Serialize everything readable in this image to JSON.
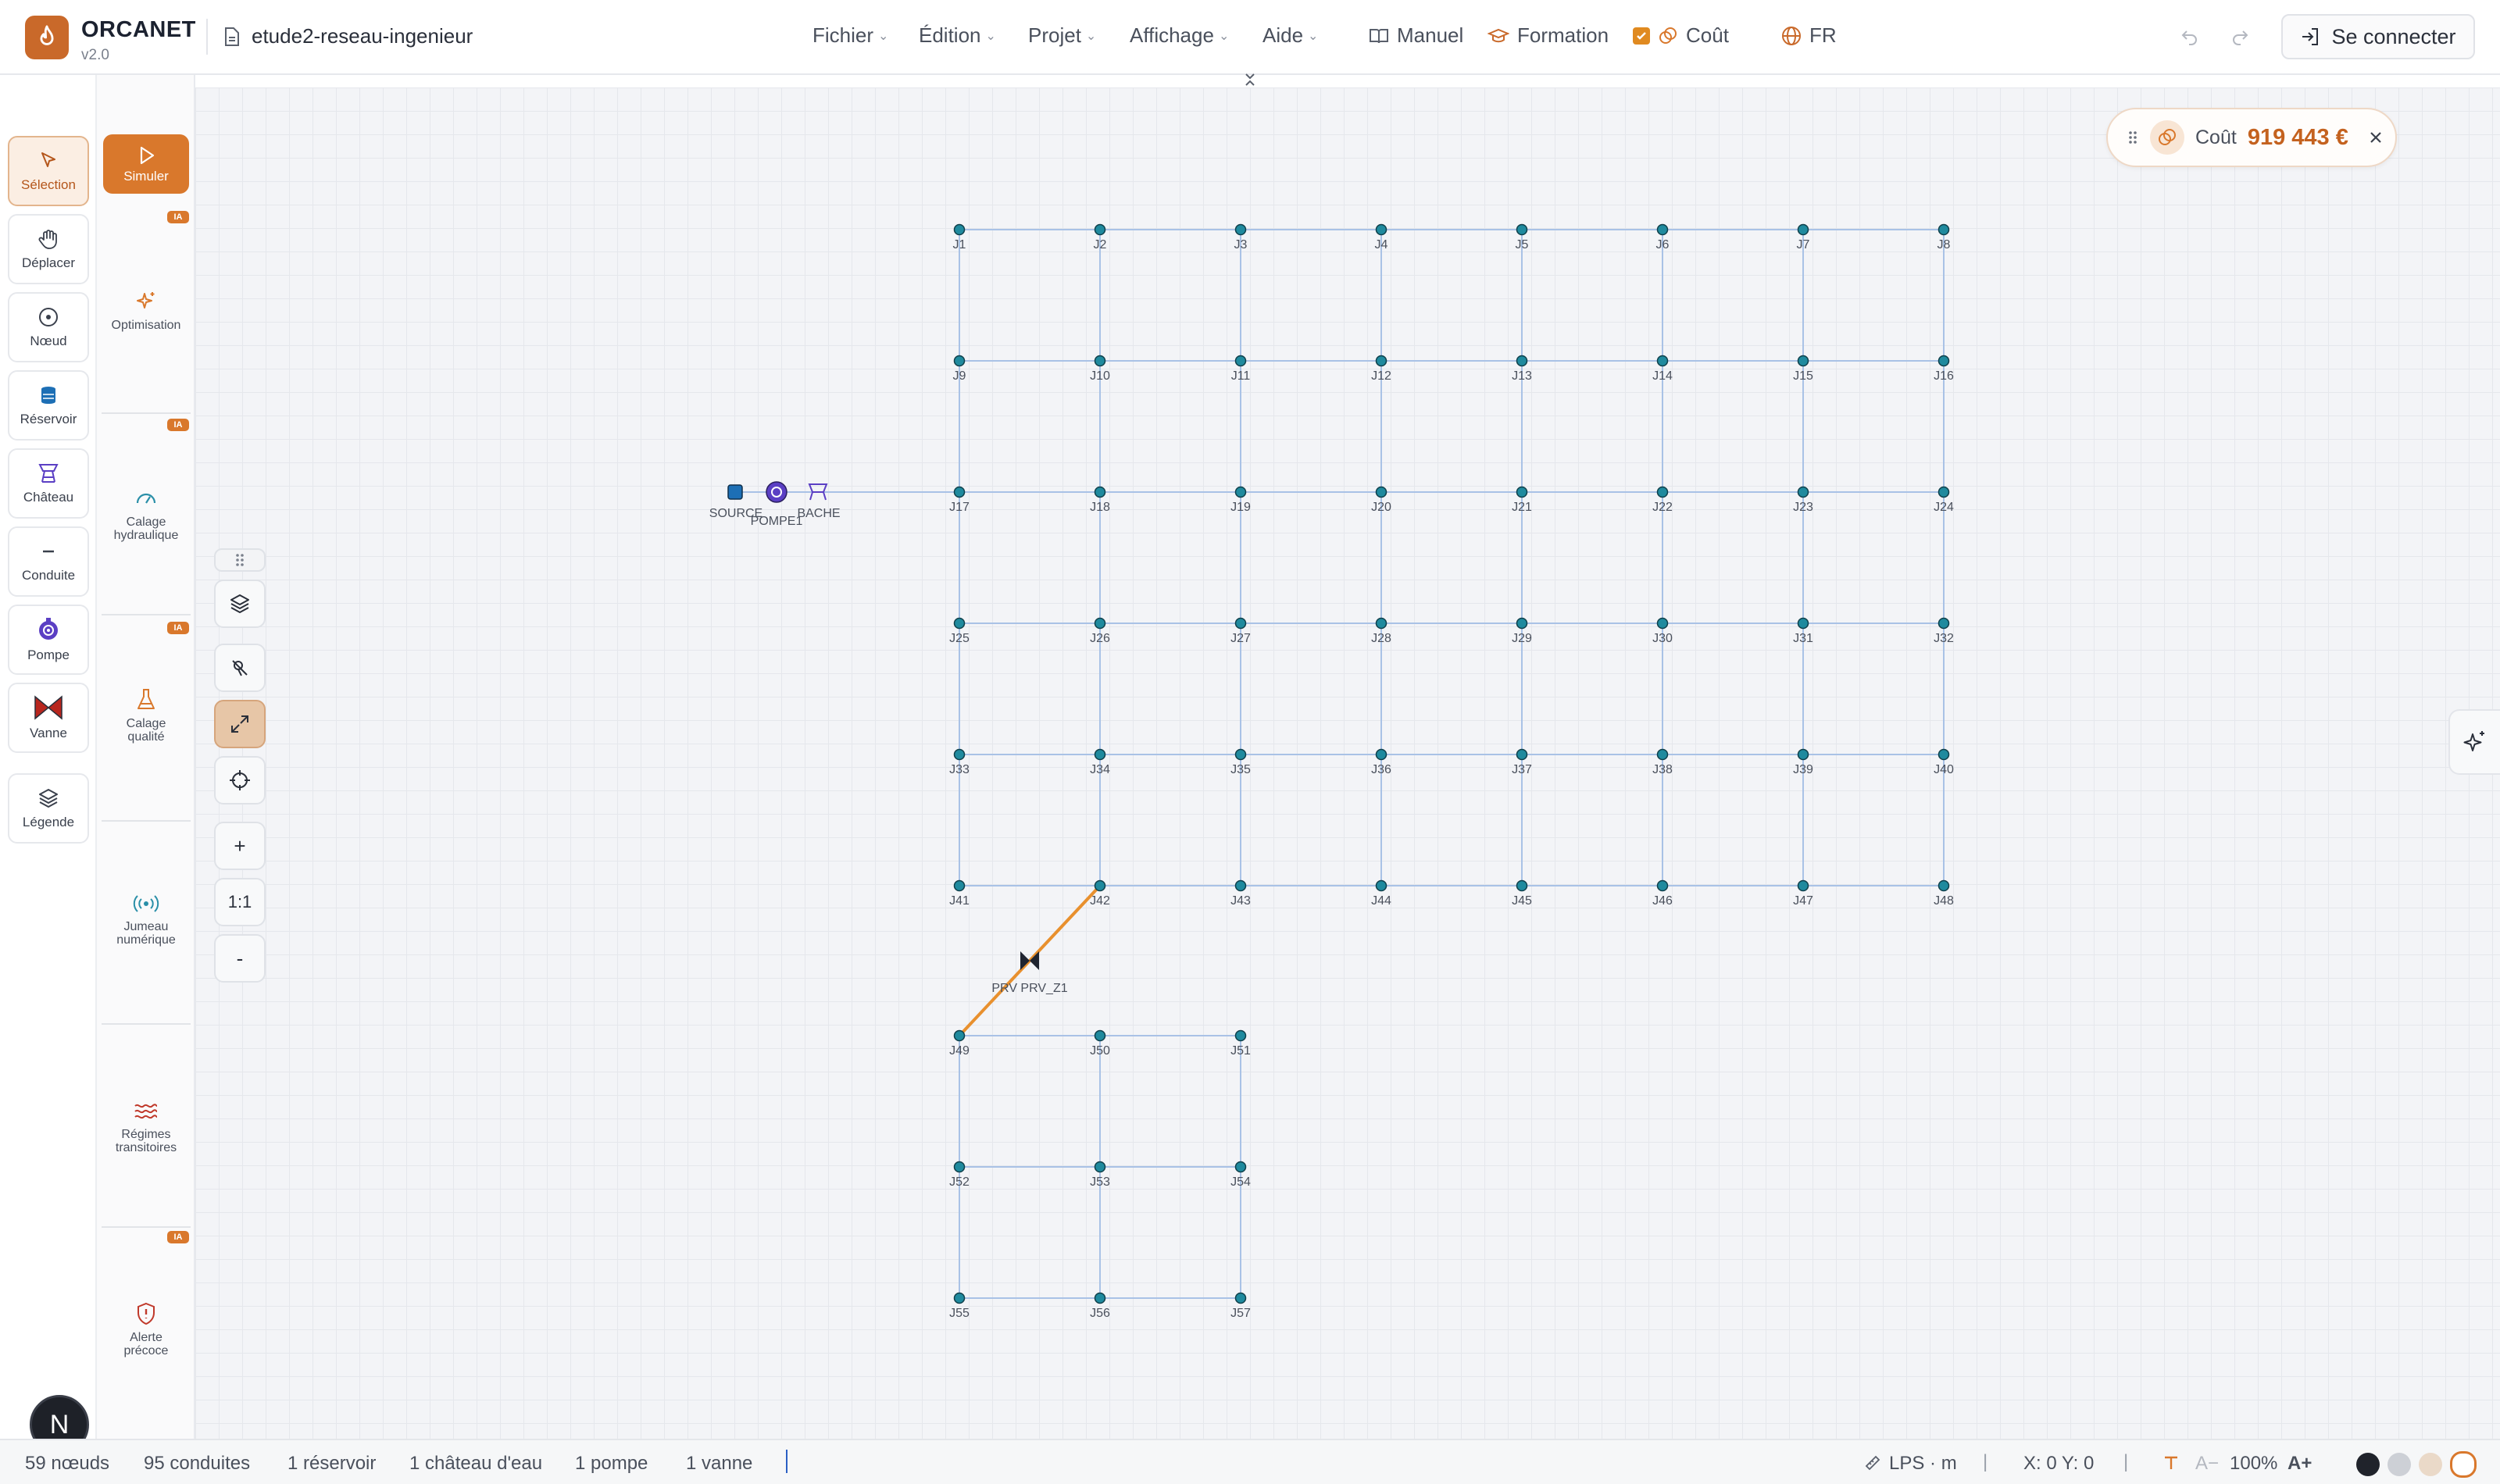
{
  "app": {
    "name": "ORCANET",
    "version": "v2.0",
    "file_name": "etude2-reseau-ingenieur"
  },
  "menus": [
    {
      "label": "Fichier"
    },
    {
      "label": "Édition"
    },
    {
      "label": "Projet"
    },
    {
      "label": "Affichage"
    },
    {
      "label": "Aide"
    }
  ],
  "header_links": {
    "manual": "Manuel",
    "training": "Formation",
    "cost": "Coût",
    "language": "FR",
    "login": "Se connecter"
  },
  "tools": [
    {
      "label": "Sélection",
      "icon": "cursor-icon",
      "active": true
    },
    {
      "label": "Déplacer",
      "icon": "hand-icon"
    },
    {
      "label": "Nœud",
      "icon": "node-icon"
    },
    {
      "label": "Réservoir",
      "icon": "reservoir-icon"
    },
    {
      "label": "Château",
      "icon": "water-tower-icon"
    },
    {
      "label": "Conduite",
      "icon": "pipe-icon"
    },
    {
      "label": "Pompe",
      "icon": "pump-icon"
    },
    {
      "label": "Vanne",
      "icon": "valve-icon"
    },
    {
      "label": "Légende",
      "icon": "layers-icon"
    }
  ],
  "modules": {
    "simulate": "Simuler",
    "ia_badge": "IA",
    "items": [
      {
        "line1": "Optimisation",
        "line2": ""
      },
      {
        "line1": "Calage",
        "line2": "hydraulique"
      },
      {
        "line1": "Calage",
        "line2": "qualité"
      },
      {
        "line1": "Jumeau",
        "line2": "numérique"
      },
      {
        "line1": "Régimes",
        "line2": "transitoires"
      },
      {
        "line1": "Alerte",
        "line2": "précoce"
      }
    ]
  },
  "map_controls": {
    "zoom_in": "+",
    "reset": "1:1",
    "zoom_out": "-"
  },
  "cost_panel": {
    "label": "Coût",
    "value": "919 443 €"
  },
  "user": {
    "initial": "N"
  },
  "network": {
    "junction_prefix": "J",
    "source_label": "SOURCE",
    "pump_label": "POMPE1",
    "tank_label": "BACHE",
    "valve_label": "PRV PRV_Z1",
    "colors": {
      "pipe": "#a9c2e6",
      "node": "#1f8a9e",
      "valve_pipe": "#e8902e",
      "pump": "#5b3fc4"
    }
  },
  "status": {
    "nodes": "59 nœuds",
    "pipes": "95 conduites",
    "reservoirs": "1 réservoir",
    "towers": "1 château d'eau",
    "pumps": "1 pompe",
    "valves": "1 vanne",
    "units": "LPS · m",
    "coords": "X: 0  Y: 0",
    "font_small": "A−",
    "zoom": "100%",
    "font_large": "A+"
  }
}
